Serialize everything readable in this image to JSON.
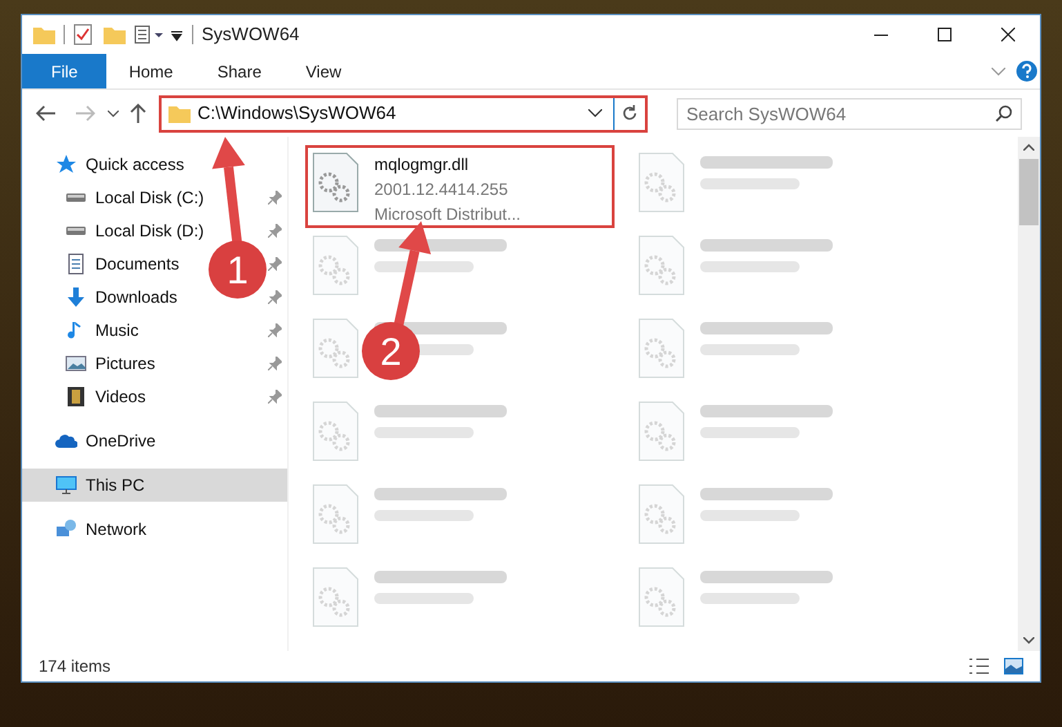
{
  "window": {
    "title": "SysWOW64"
  },
  "ribbon_tabs": [
    {
      "label": "File",
      "selected": true
    },
    {
      "label": "Home",
      "selected": false
    },
    {
      "label": "Share",
      "selected": false
    },
    {
      "label": "View",
      "selected": false
    }
  ],
  "address_bar": {
    "value": "C:\\Windows\\SysWOW64"
  },
  "search": {
    "placeholder": "Search SysWOW64"
  },
  "sidebar": {
    "items": [
      {
        "label": "Quick access",
        "kind": "quick",
        "pinned": false,
        "selected": false
      },
      {
        "label": "Local Disk (C:)",
        "kind": "disk",
        "pinned": true,
        "selected": false
      },
      {
        "label": "Local Disk (D:)",
        "kind": "disk",
        "pinned": true,
        "selected": false
      },
      {
        "label": "Documents",
        "kind": "documents",
        "pinned": true,
        "selected": false
      },
      {
        "label": "Downloads",
        "kind": "downloads",
        "pinned": true,
        "selected": false
      },
      {
        "label": "Music",
        "kind": "music",
        "pinned": true,
        "selected": false
      },
      {
        "label": "Pictures",
        "kind": "pictures",
        "pinned": true,
        "selected": false
      },
      {
        "label": "Videos",
        "kind": "videos",
        "pinned": true,
        "selected": false
      },
      {
        "label": "OneDrive",
        "kind": "cloud",
        "pinned": false,
        "selected": false
      },
      {
        "label": "This PC",
        "kind": "pc",
        "pinned": false,
        "selected": true
      },
      {
        "label": "Network",
        "kind": "network",
        "pinned": false,
        "selected": false
      }
    ]
  },
  "files": [
    {
      "name": "mqlogmgr.dll",
      "lines": [
        "2001.12.4414.255",
        "Microsoft Distribut..."
      ],
      "blurred": false,
      "highlighted": true
    },
    {
      "blurred": true,
      "highlighted": false
    },
    {
      "blurred": true,
      "highlighted": false
    },
    {
      "blurred": true,
      "highlighted": false
    },
    {
      "blurred": true,
      "highlighted": false
    },
    {
      "blurred": true,
      "highlighted": false
    },
    {
      "blurred": true,
      "highlighted": false
    },
    {
      "blurred": true,
      "highlighted": false
    },
    {
      "blurred": true,
      "highlighted": false
    },
    {
      "blurred": true,
      "highlighted": false
    },
    {
      "blurred": true,
      "highlighted": false
    },
    {
      "blurred": true,
      "highlighted": false
    }
  ],
  "status_bar": {
    "item_count": "174 items"
  },
  "annotations": [
    {
      "number": "1"
    },
    {
      "number": "2"
    }
  ]
}
